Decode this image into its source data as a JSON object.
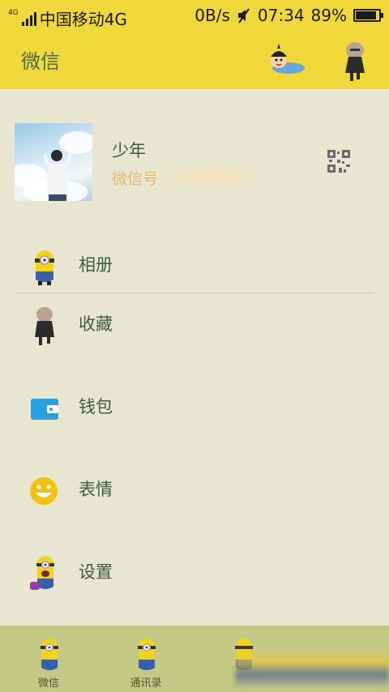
{
  "status_bar": {
    "network_small": "4G",
    "carrier": "中国移动4G",
    "speed": "0B/s",
    "time": "07:34",
    "battery": "89%",
    "battery_level": 0.89
  },
  "header": {
    "title": "微信"
  },
  "profile": {
    "name": "少年",
    "wechat_id_label": "微信号"
  },
  "menu": [
    {
      "label": "相册",
      "icon": "minion-icon"
    },
    {
      "label": "收藏",
      "icon": "gru-icon"
    },
    {
      "label": "钱包",
      "icon": "wallet-icon"
    },
    {
      "label": "表情",
      "icon": "smiley-icon"
    },
    {
      "label": "设置",
      "icon": "minion-settings-icon"
    }
  ],
  "tabs": [
    {
      "label": "微信",
      "icon": "minion-icon"
    },
    {
      "label": "通讯录",
      "icon": "minion-icon"
    },
    {
      "label": "",
      "icon": "minion-icon"
    }
  ],
  "colors": {
    "header_bg": "#f1d83a",
    "page_bg": "#e8e6d0",
    "tabbar_bg": "#c3c985",
    "text_green": "#3f5c3a",
    "wxid_orange": "#e2b96b",
    "wallet_blue": "#2a9fe0",
    "smiley_yellow": "#f2c20e"
  }
}
